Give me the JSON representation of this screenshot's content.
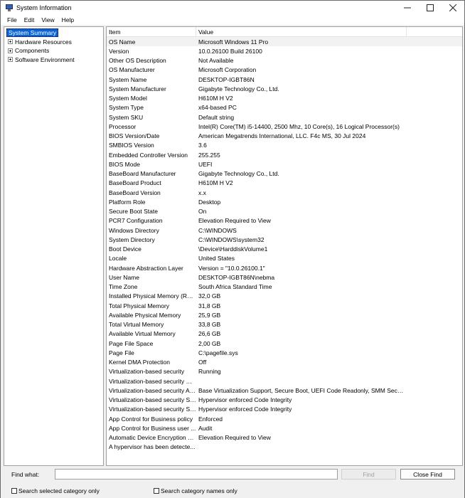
{
  "window": {
    "title": "System Information"
  },
  "menu": [
    "File",
    "Edit",
    "View",
    "Help"
  ],
  "tree": {
    "root": "System Summary",
    "children": [
      "Hardware Resources",
      "Components",
      "Software Environment"
    ]
  },
  "list": {
    "headers": {
      "item": "Item",
      "value": "Value"
    },
    "rows": [
      [
        "OS Name",
        "Microsoft Windows 11 Pro"
      ],
      [
        "Version",
        "10.0.26100 Build 26100"
      ],
      [
        "Other OS Description",
        "Not Available"
      ],
      [
        "OS Manufacturer",
        "Microsoft Corporation"
      ],
      [
        "System Name",
        "DESKTOP-IGBT86N"
      ],
      [
        "System Manufacturer",
        "Gigabyte Technology Co., Ltd."
      ],
      [
        "System Model",
        "H610M H V2"
      ],
      [
        "System Type",
        "x64-based PC"
      ],
      [
        "System SKU",
        "Default string"
      ],
      [
        "Processor",
        "Intel(R) Core(TM) i5-14400, 2500 Mhz, 10 Core(s), 16 Logical Processor(s)"
      ],
      [
        "BIOS Version/Date",
        "American Megatrends International, LLC. F4c MS, 30 Jul 2024"
      ],
      [
        "SMBIOS Version",
        "3.6"
      ],
      [
        "Embedded Controller Version",
        "255.255"
      ],
      [
        "BIOS Mode",
        "UEFI"
      ],
      [
        "BaseBoard Manufacturer",
        "Gigabyte Technology Co., Ltd."
      ],
      [
        "BaseBoard Product",
        "H610M H V2"
      ],
      [
        "BaseBoard Version",
        "x.x"
      ],
      [
        "Platform Role",
        "Desktop"
      ],
      [
        "Secure Boot State",
        "On"
      ],
      [
        "PCR7 Configuration",
        "Elevation Required to View"
      ],
      [
        "Windows Directory",
        "C:\\WINDOWS"
      ],
      [
        "System Directory",
        "C:\\WINDOWS\\system32"
      ],
      [
        "Boot Device",
        "\\Device\\HarddiskVolume1"
      ],
      [
        "Locale",
        "United States"
      ],
      [
        "Hardware Abstraction Layer",
        "Version = \"10.0.26100.1\""
      ],
      [
        "User Name",
        "DESKTOP-IGBT86N\\nebma"
      ],
      [
        "Time Zone",
        "South Africa Standard Time"
      ],
      [
        "Installed Physical Memory (RAM)",
        "32,0 GB"
      ],
      [
        "Total Physical Memory",
        "31,8 GB"
      ],
      [
        "Available Physical Memory",
        "25,9 GB"
      ],
      [
        "Total Virtual Memory",
        "33,8 GB"
      ],
      [
        "Available Virtual Memory",
        "26,6 GB"
      ],
      [
        "Page File Space",
        "2,00 GB"
      ],
      [
        "Page File",
        "C:\\pagefile.sys"
      ],
      [
        "Kernel DMA Protection",
        "Off"
      ],
      [
        "Virtualization-based security",
        "Running"
      ],
      [
        "Virtualization-based security Re...",
        ""
      ],
      [
        "Virtualization-based security Av...",
        "Base Virtualization Support, Secure Boot, UEFI Code Readonly, SMM Security..."
      ],
      [
        "Virtualization-based security Se...",
        "Hypervisor enforced Code Integrity"
      ],
      [
        "Virtualization-based security Se...",
        "Hypervisor enforced Code Integrity"
      ],
      [
        "App Control for Business policy",
        "Enforced"
      ],
      [
        "App Control for Business user ...",
        "Audit"
      ],
      [
        "Automatic Device Encryption Su...",
        "Elevation Required to View"
      ],
      [
        "A hypervisor has been detecte...",
        ""
      ]
    ]
  },
  "find": {
    "label": "Find what:",
    "value": "",
    "find_button": "Find",
    "close_button": "Close Find",
    "check_selected": "Search selected category only",
    "check_names": "Search category names only"
  },
  "icons": {
    "app": "system-information-icon",
    "minimize": "minimize-icon",
    "maximize": "maximize-icon",
    "close": "close-icon",
    "expand": "plus-expander-icon"
  }
}
